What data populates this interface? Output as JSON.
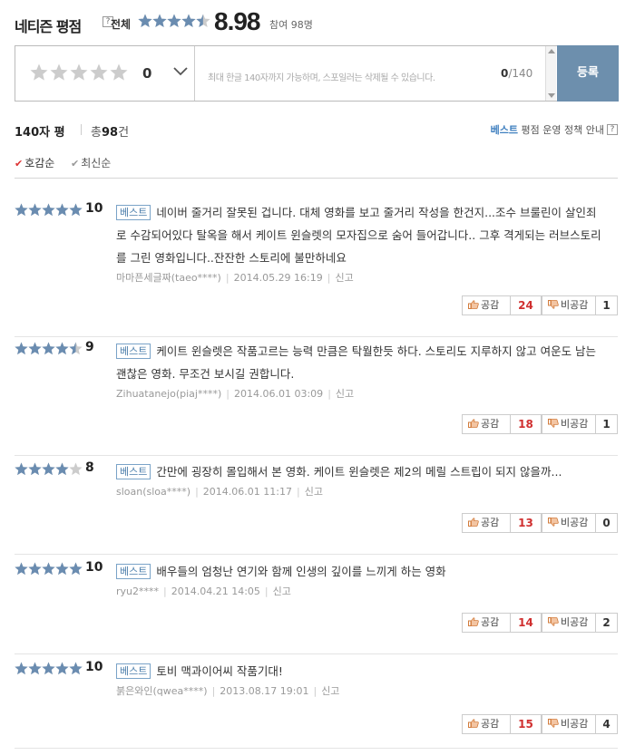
{
  "header": {
    "title": "네티즌 평점",
    "help": "?",
    "all_label": "전체",
    "score": "8.98",
    "score_rating": 8.98,
    "participants": "참여 98명"
  },
  "input": {
    "score": "0",
    "placeholder": "최대 한글 140자까지 가능하며, 스포일러는 삭제될 수 있습니다.",
    "count_current": "0",
    "count_max": "/140",
    "submit_label": "등록"
  },
  "summary": {
    "left_label": "140자 평",
    "total_prefix": "총",
    "total_count": "98",
    "total_suffix": "건",
    "best_label": "베스트",
    "policy_label": "평점 운영 정책 안내",
    "help": "?"
  },
  "sorts": [
    {
      "label": "호감순",
      "checkmark": "✔",
      "selected": true
    },
    {
      "label": "최신순",
      "checkmark": "✔",
      "selected": false
    }
  ],
  "reviews": [
    {
      "score": "10",
      "rating": 10,
      "badge": "베스트",
      "text": "네이버 줄거리 잘못된 겁니다. 대체 영화를 보고 줄거리 작성을 한건지...조수 브룰린이 살인죄로 수감되어있다 탈옥을 해서 케이트 윈슬렛의 모자집으로 숨어 들어갑니다.. 그후 격게되는 러브스토리를 그린 영화입니다..잔잔한 스토리에 불만하네요",
      "author": "마마픈세글짜(taeo****)",
      "date": "2014.05.29 16:19",
      "report": "신고",
      "like_label": "공감",
      "like_count": "24",
      "dislike_label": "비공감",
      "dislike_count": "1"
    },
    {
      "score": "9",
      "rating": 9,
      "badge": "베스트",
      "text": "케이트 윈슬렛은 작품고르는 능력 만큼은 탁월한듯 하다. 스토리도 지루하지 않고 여운도 남는 괜찮은 영화. 무조건 보시길 권합니다.",
      "author": "Zihuatanejo(piaj****)",
      "date": "2014.06.01 03:09",
      "report": "신고",
      "like_label": "공감",
      "like_count": "18",
      "dislike_label": "비공감",
      "dislike_count": "1"
    },
    {
      "score": "8",
      "rating": 8,
      "badge": "베스트",
      "text": "간만에 굉장히 몰입해서 본 영화. 케이트 윈슬렛은 제2의 메릴 스트립이 되지 않을까...",
      "author": "sloan(sloa****)",
      "date": "2014.06.01 11:17",
      "report": "신고",
      "like_label": "공감",
      "like_count": "13",
      "dislike_label": "비공감",
      "dislike_count": "0"
    },
    {
      "score": "10",
      "rating": 10,
      "badge": "베스트",
      "text": "배우들의 엄청난 연기와 함께 인생의 깊이를 느끼게 하는 영화",
      "author": "ryu2****",
      "date": "2014.04.21 14:05",
      "report": "신고",
      "like_label": "공감",
      "like_count": "14",
      "dislike_label": "비공감",
      "dislike_count": "2"
    },
    {
      "score": "10",
      "rating": 10,
      "badge": "베스트",
      "text": "토비 맥과이어씨 작품기대!",
      "author": "붉은와인(qwea****)",
      "date": "2013.08.17 19:01",
      "report": "신고",
      "like_label": "공감",
      "like_count": "15",
      "dislike_label": "비공감",
      "dislike_count": "4"
    }
  ],
  "colors": {
    "star_filled": "#6a8cb0",
    "star_empty": "#cccccc",
    "submit": "#6d8fad",
    "like_count": "#d03030",
    "best_badge": "#4b7eab"
  }
}
